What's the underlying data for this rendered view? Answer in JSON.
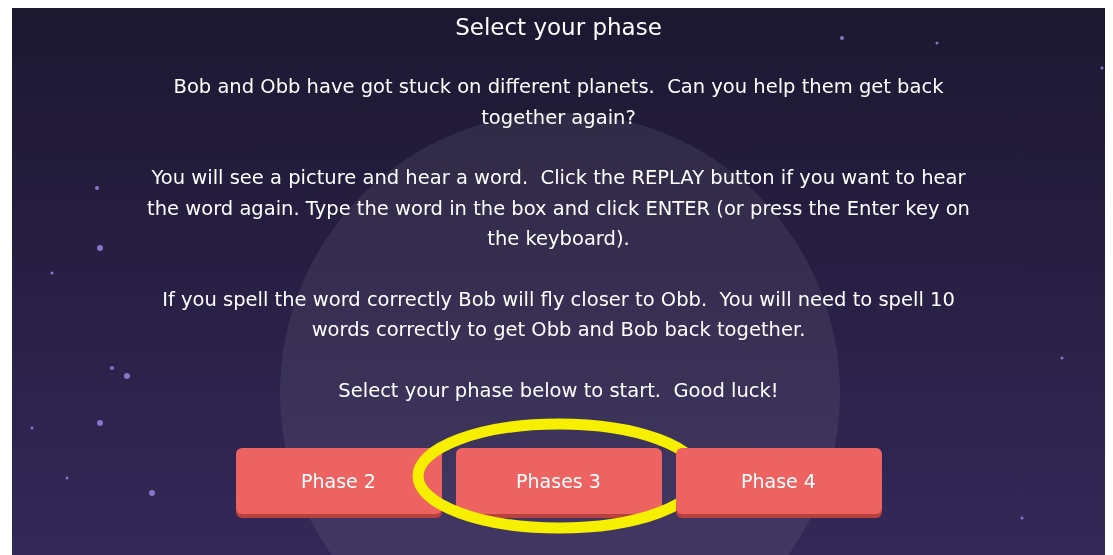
{
  "title": "Select your phase",
  "paragraphs": [
    "Bob and Obb have got stuck on different planets.  Can you help them get back together again?",
    "You will see a picture and hear a word.  Click the REPLAY button if you want to hear the word again. Type the word in the box and click ENTER (or press the Enter key on the keyboard).",
    "If you spell the word correctly Bob will fly closer to Obb.  You will need to spell 10 words correctly to get Obb and Bob back together.",
    "Select your phase below to start.  Good luck!"
  ],
  "buttons": [
    {
      "label": "Phase 2",
      "highlighted": false
    },
    {
      "label": "Phases 3",
      "highlighted": true
    },
    {
      "label": "Phase 4",
      "highlighted": false
    }
  ]
}
